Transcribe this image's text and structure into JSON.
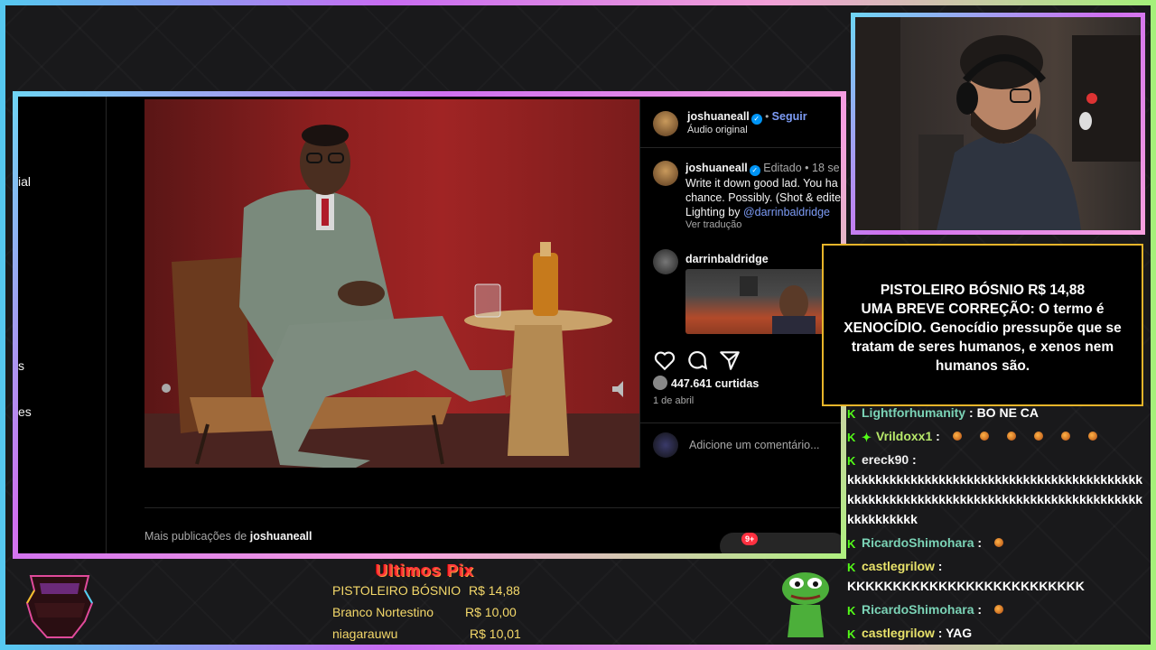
{
  "left_nav": {
    "labels": [
      "ial",
      "s",
      "es"
    ]
  },
  "post": {
    "header": {
      "username": "joshuaneall",
      "follow_label": "Seguir",
      "audio_label": "Áudio original"
    },
    "caption": {
      "username": "joshuaneall",
      "edited_label": "Editado",
      "age": "18 se",
      "line1": "Write it down good lad. You ha",
      "line2": "chance. Possibly. (Shot & edite",
      "line3_prefix": "Lighting by ",
      "line3_link": "@darrinbaldridge",
      "translate_label": "Ver tradução"
    },
    "reply": {
      "username": "darrinbaldridge"
    },
    "likes_label": "447.641 curtidas",
    "date_label": "1 de abril",
    "comment_placeholder": "Adicione um comentário...",
    "more_posts_prefix": "Mais publicações de ",
    "more_posts_user": "joshuaneall",
    "notif_badge": "9+"
  },
  "alert": {
    "title": "PISTOLEIRO BÓSNIO R$ 14,88",
    "message": "UMA BREVE CORREÇÃO: O termo é XENOCÍDIO. Genocídio pressupõe que se tratam de seres humanos, e xenos nem humanos são."
  },
  "chat": {
    "messages": [
      {
        "user": "Lightforhumanity",
        "text": "BO NE CA"
      },
      {
        "user": "Vrildoxx1",
        "text": ""
      },
      {
        "user": "ereck90",
        "text": "kkkkkkkkkkkkkkkkkkkkkkkkkkkkkkkkkkkkkkkkkkkkkkkkkkkkkkkkkkkkkkkkkkkkkkkkkkkkkkkkkkkkkkkkkkkkkk"
      },
      {
        "user": "RicardoShimohara",
        "text": ""
      },
      {
        "user": "castlegrilow",
        "text": "KKKKKKKKKKKKKKKKKKKKKKKKKK"
      },
      {
        "user": "RicardoShimohara",
        "text": ""
      },
      {
        "user": "castlegrilow",
        "text": "YAG"
      }
    ]
  },
  "pix": {
    "title": "Ultimos Pix",
    "entries": [
      {
        "name": "PISTOLEIRO BÓSNIO",
        "amount": "R$ 14,88"
      },
      {
        "name": "Branco Nortestino",
        "amount": "R$ 10,00"
      },
      {
        "name": "niagarauwu",
        "amount": "R$ 10,01"
      }
    ]
  },
  "colors": {
    "alert_border": "#e8b52a",
    "kick_green": "#53fc18",
    "pix_gold": "#f5d96a",
    "pix_red": "#ff3b3b",
    "instagram_link": "#7d9cf6"
  }
}
